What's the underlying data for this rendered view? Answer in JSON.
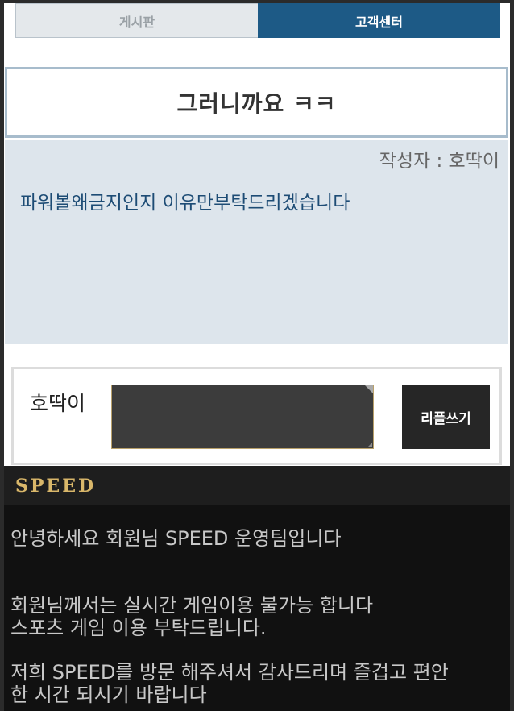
{
  "tabs": {
    "board": "게시판",
    "support": "고객센터"
  },
  "post": {
    "title": "그러니까요 ㅋㅋ",
    "author": "작성자 : 호딱이",
    "body": "파워볼왜금지인지 이유만부탁드리겠습니다"
  },
  "reply": {
    "name": "호딱이",
    "input_value": "",
    "button_label": "리플쓰기"
  },
  "footer": {
    "logo": "SPEED",
    "lines": [
      "안녕하세요 회원님 SPEED 운영팀입니다",
      "회원님께서는 실시간 게임이용 불가능 합니다",
      "스포츠 게임 이용 부탁드립니다.",
      "저희 SPEED를 방문 해주셔서 감사드리며 즐겁고 편안",
      "한 시간 되시기 바랍니다"
    ]
  },
  "colors": {
    "accent_blue": "#1d5a86",
    "content_bg": "#dde5ec",
    "logo_gold": "#d9b76a"
  }
}
